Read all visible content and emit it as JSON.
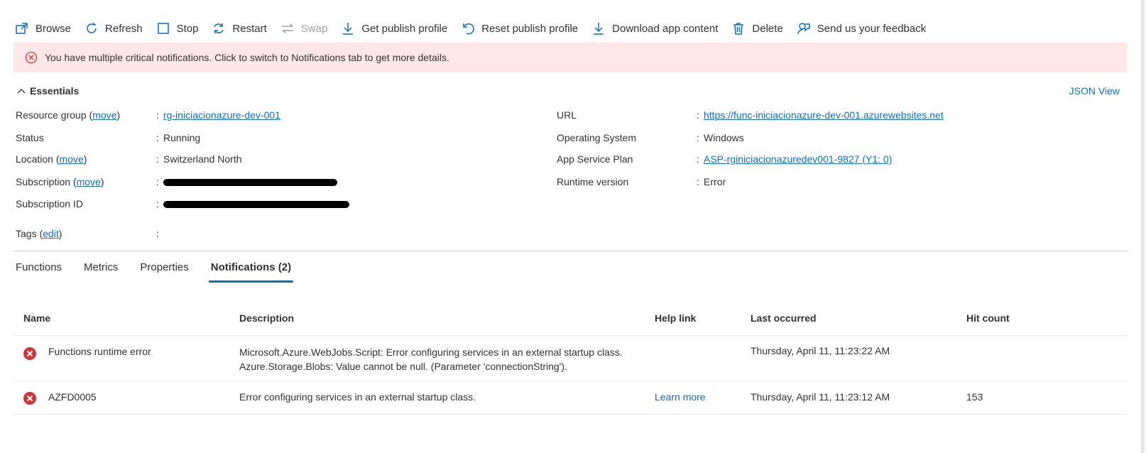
{
  "toolbar": {
    "browse": "Browse",
    "refresh": "Refresh",
    "stop": "Stop",
    "restart": "Restart",
    "swap": "Swap",
    "get_publish_profile": "Get publish profile",
    "reset_publish_profile": "Reset publish profile",
    "download_app_content": "Download app content",
    "delete": "Delete",
    "feedback": "Send us your feedback"
  },
  "banner": {
    "text": "You have multiple critical notifications. Click to switch to Notifications tab to get more details.",
    "color": "#fde7e9"
  },
  "essentials": {
    "title": "Essentials",
    "json_view": "JSON View",
    "left": {
      "resource_group_label": "Resource group",
      "move_link": "move",
      "resource_group_value": "rg-iniciacionazure-dev-001",
      "status_label": "Status",
      "status_value": "Running",
      "location_label": "Location",
      "location_value": "Switzerland North",
      "subscription_label": "Subscription",
      "subscription_id_label": "Subscription ID",
      "tags_label": "Tags",
      "edit_link": "edit"
    },
    "right": {
      "url_label": "URL",
      "url_value": "https://func-iniciacionazure-dev-001.azurewebsites.net",
      "os_label": "Operating System",
      "os_value": "Windows",
      "plan_label": "App Service Plan",
      "plan_value": "ASP-rginiciacionazuredev001-9827 (Y1: 0)",
      "runtime_label": "Runtime version",
      "runtime_value": "Error"
    },
    "colon": ":"
  },
  "tabs": [
    {
      "label": "Functions"
    },
    {
      "label": "Metrics"
    },
    {
      "label": "Properties"
    },
    {
      "label": "Notifications (2)"
    }
  ],
  "table": {
    "headers": {
      "name": "Name",
      "description": "Description",
      "help_link": "Help link",
      "last_occurred": "Last occurred",
      "hit_count": "Hit count"
    },
    "rows": [
      {
        "name": "Functions runtime error",
        "description_line1": "Microsoft.Azure.WebJobs.Script: Error configuring services in an external startup class.",
        "description_line2": "Azure.Storage.Blobs: Value cannot be null. (Parameter 'connectionString').",
        "help_link": "",
        "last_occurred": "Thursday, April 11, 11:23:22 AM",
        "hit_count": ""
      },
      {
        "name": "AZFD0005",
        "description_line1": "Error configuring services in an external startup class.",
        "help_link": "Learn more",
        "last_occurred": "Thursday, April 11, 11:23:12 AM",
        "hit_count": "153"
      }
    ]
  },
  "colors": {
    "accent": "#0f6cbd",
    "error": "#d13438"
  },
  "icons": [
    "browse-icon",
    "refresh-icon",
    "stop-icon",
    "restart-icon",
    "swap-icon",
    "download-icon",
    "undo-icon",
    "delete-icon",
    "feedback-icon",
    "error-circle-icon",
    "chevron-up-icon"
  ]
}
